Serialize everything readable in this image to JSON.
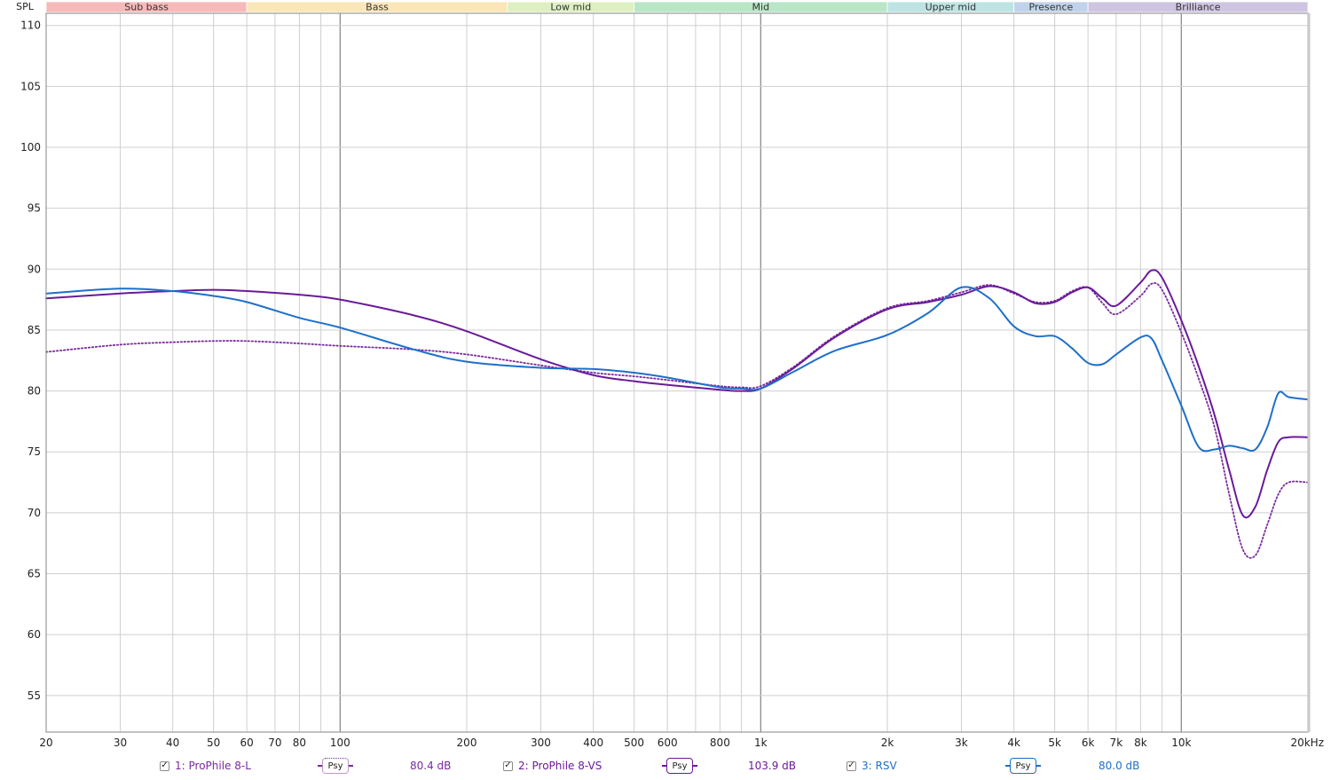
{
  "chart_data": {
    "type": "line",
    "title": "",
    "ylabel": "SPL",
    "xlabel": "",
    "x_scale": "log",
    "xlim": [
      20,
      20000
    ],
    "ylim": [
      52,
      111
    ],
    "y_ticks": [
      55,
      60,
      65,
      70,
      75,
      80,
      85,
      90,
      95,
      100,
      105,
      110
    ],
    "x_ticks": [
      {
        "v": 20,
        "label": "20"
      },
      {
        "v": 30,
        "label": "30"
      },
      {
        "v": 40,
        "label": "40"
      },
      {
        "v": 50,
        "label": "50"
      },
      {
        "v": 60,
        "label": "60"
      },
      {
        "v": 70,
        "label": "70"
      },
      {
        "v": 80,
        "label": "80"
      },
      {
        "v": 100,
        "label": "100"
      },
      {
        "v": 200,
        "label": "200"
      },
      {
        "v": 300,
        "label": "300"
      },
      {
        "v": 400,
        "label": "400"
      },
      {
        "v": 500,
        "label": "500"
      },
      {
        "v": 600,
        "label": "600"
      },
      {
        "v": 800,
        "label": "800"
      },
      {
        "v": 1000,
        "label": "1k"
      },
      {
        "v": 2000,
        "label": "2k"
      },
      {
        "v": 3000,
        "label": "3k"
      },
      {
        "v": 4000,
        "label": "4k"
      },
      {
        "v": 5000,
        "label": "5k"
      },
      {
        "v": 6000,
        "label": "6k"
      },
      {
        "v": 7000,
        "label": "7k"
      },
      {
        "v": 8000,
        "label": "8k"
      },
      {
        "v": 10000,
        "label": "10k"
      },
      {
        "v": 20000,
        "label": "20kHz"
      }
    ],
    "bands": [
      {
        "name": "Sub bass",
        "from": 20,
        "to": 60,
        "color": "#f7b9b9"
      },
      {
        "name": "Bass",
        "from": 60,
        "to": 250,
        "color": "#fbe6b8"
      },
      {
        "name": "Low mid",
        "from": 250,
        "to": 500,
        "color": "#def0c2"
      },
      {
        "name": "Mid",
        "from": 500,
        "to": 2000,
        "color": "#b9e6c6"
      },
      {
        "name": "Upper mid",
        "from": 2000,
        "to": 4000,
        "color": "#bde4e2"
      },
      {
        "name": "Presence",
        "from": 4000,
        "to": 6000,
        "color": "#c0d3ea"
      },
      {
        "name": "Brilliance",
        "from": 6000,
        "to": 20000,
        "color": "#cfc4e2"
      }
    ],
    "series": [
      {
        "name": "1: ProPhile 8-L",
        "color": "#7a2a9e",
        "style": "dotted",
        "level": "80.4 dB",
        "x": [
          20,
          30,
          40,
          50,
          60,
          80,
          100,
          150,
          200,
          300,
          400,
          500,
          600,
          800,
          900,
          1000,
          1200,
          1500,
          2000,
          2500,
          3000,
          3500,
          4000,
          4500,
          5000,
          5500,
          6000,
          6500,
          7000,
          8000,
          8500,
          9000,
          10000,
          11000,
          12000,
          13000,
          14000,
          15000,
          16000,
          17000,
          18000,
          20000
        ],
        "y": [
          83.2,
          83.8,
          84.0,
          84.1,
          84.1,
          83.9,
          83.7,
          83.4,
          83.0,
          82.1,
          81.5,
          81.2,
          80.9,
          80.4,
          80.3,
          80.4,
          82.0,
          84.5,
          86.8,
          87.4,
          88.1,
          88.7,
          88.0,
          87.3,
          87.4,
          88.2,
          88.5,
          87.2,
          86.3,
          87.8,
          88.8,
          88.3,
          84.8,
          81.0,
          77.0,
          71.5,
          67.0,
          66.5,
          69.0,
          71.5,
          72.5,
          72.5
        ]
      },
      {
        "name": "2: ProPhile 8-VS",
        "color": "#6a1a9a",
        "style": "solid",
        "level": "103.9 dB",
        "x": [
          20,
          30,
          40,
          50,
          60,
          80,
          100,
          150,
          200,
          300,
          400,
          500,
          600,
          800,
          900,
          1000,
          1200,
          1500,
          2000,
          2500,
          3000,
          3500,
          4000,
          4500,
          5000,
          5500,
          6000,
          6500,
          7000,
          8000,
          8500,
          9000,
          10000,
          11000,
          12000,
          13000,
          14000,
          15000,
          16000,
          17000,
          18000,
          20000
        ],
        "y": [
          87.6,
          88.0,
          88.2,
          88.3,
          88.2,
          87.9,
          87.5,
          86.2,
          84.9,
          82.6,
          81.3,
          80.8,
          80.5,
          80.1,
          80.0,
          80.2,
          81.9,
          84.4,
          86.7,
          87.3,
          87.9,
          88.6,
          88.1,
          87.2,
          87.3,
          88.1,
          88.5,
          87.6,
          87.0,
          88.9,
          89.9,
          89.3,
          85.8,
          82.0,
          78.0,
          73.5,
          69.8,
          70.5,
          73.5,
          75.8,
          76.2,
          76.2
        ]
      },
      {
        "name": "3: RSV",
        "color": "#1f6fc9",
        "style": "solid",
        "level": "80.0 dB",
        "x": [
          20,
          30,
          40,
          50,
          60,
          80,
          100,
          150,
          200,
          300,
          400,
          500,
          600,
          800,
          900,
          1000,
          1200,
          1500,
          2000,
          2500,
          3000,
          3500,
          4000,
          4500,
          5000,
          5500,
          6000,
          6500,
          7000,
          8000,
          8500,
          9000,
          10000,
          11000,
          12000,
          13000,
          14000,
          15000,
          16000,
          17000,
          18000,
          20000
        ],
        "y": [
          88.0,
          88.4,
          88.2,
          87.8,
          87.3,
          86.0,
          85.2,
          83.4,
          82.4,
          81.9,
          81.8,
          81.5,
          81.1,
          80.3,
          80.2,
          80.2,
          81.6,
          83.3,
          84.6,
          86.4,
          88.5,
          87.6,
          85.3,
          84.5,
          84.5,
          83.5,
          82.3,
          82.2,
          83.0,
          84.4,
          84.3,
          82.5,
          78.8,
          75.4,
          75.2,
          75.5,
          75.3,
          75.2,
          77.0,
          79.8,
          79.5,
          79.3
        ]
      }
    ]
  },
  "legend": {
    "check_glyph": "✓",
    "psy_label": "Psy"
  }
}
